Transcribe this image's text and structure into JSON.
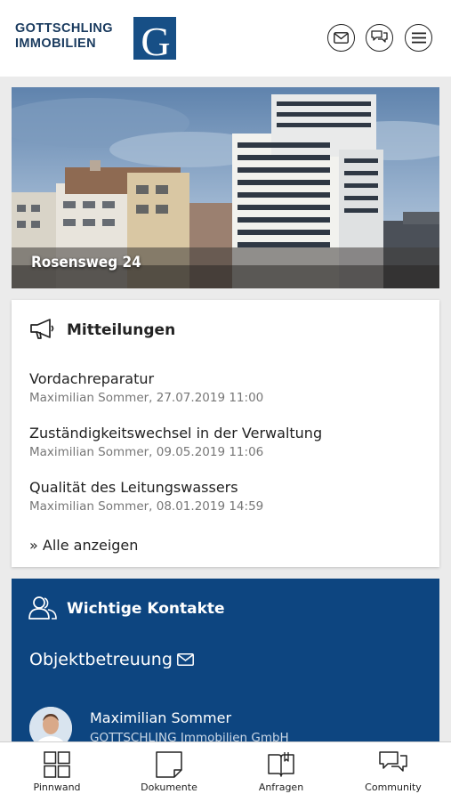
{
  "header": {
    "logo_line1": "GOTTSCHLING",
    "logo_line2": "IMMOBILIEN",
    "logo_letter": "G",
    "brand_color": "#174f86"
  },
  "property": {
    "name": "Rosensweg 24"
  },
  "messages": {
    "title": "Mitteilungen",
    "items": [
      {
        "title": "Vordachreparatur",
        "meta": "Maximilian Sommer, 27.07.2019 11:00"
      },
      {
        "title": "Zuständigkeitswechsel in der Verwaltung",
        "meta": "Maximilian Sommer, 09.05.2019 11:06"
      },
      {
        "title": "Qualität des Leitungswassers",
        "meta": "Maximilian Sommer, 08.01.2019 14:59"
      }
    ],
    "show_all": "» Alle anzeigen"
  },
  "contacts": {
    "title": "Wichtige Kontakte",
    "section": "Objektbetreuung",
    "person_name": "Maximilian Sommer",
    "person_company": "GOTTSCHLING Immobilien GmbH",
    "panel_color": "#0d4580"
  },
  "tabs": [
    {
      "label": "Pinnwand",
      "icon": "grid-icon"
    },
    {
      "label": "Dokumente",
      "icon": "document-icon"
    },
    {
      "label": "Anfragen",
      "icon": "book-icon"
    },
    {
      "label": "Community",
      "icon": "chat-icon"
    }
  ]
}
